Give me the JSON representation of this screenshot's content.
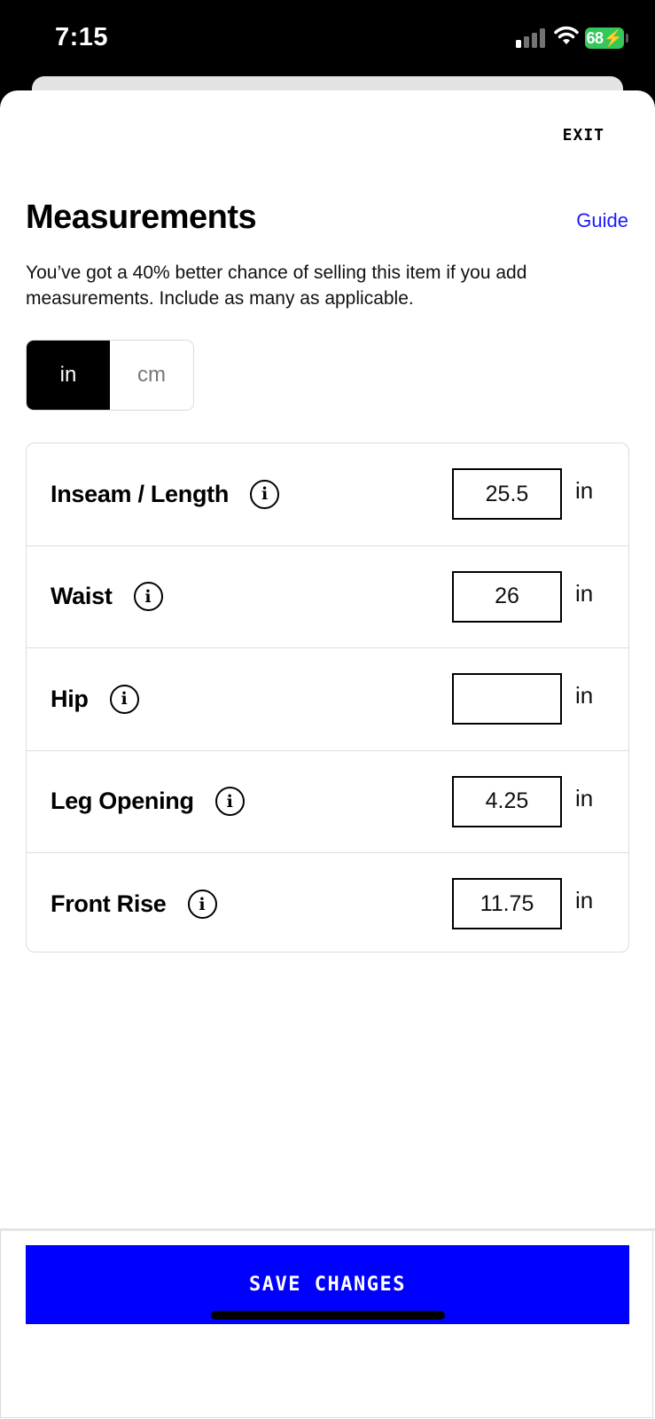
{
  "status_bar": {
    "time": "7:15",
    "battery_level": "68",
    "icons": [
      "signal-icon",
      "wifi-icon",
      "battery-charging-icon"
    ]
  },
  "header": {
    "exit_label": "EXIT",
    "title": "Measurements",
    "guide_label": "Guide",
    "description": "You’ve got a 40% better chance of selling this item if you add measurements. Include as many as applicable."
  },
  "units": {
    "options": [
      "in",
      "cm"
    ],
    "selected": "in"
  },
  "measurements": [
    {
      "label": "Inseam / Length",
      "value": "25.5",
      "unit": "in"
    },
    {
      "label": "Waist",
      "value": "26",
      "unit": "in"
    },
    {
      "label": "Hip",
      "value": "",
      "unit": "in"
    },
    {
      "label": "Leg Opening",
      "value": "4.25",
      "unit": "in"
    },
    {
      "label": "Front Rise",
      "value": "11.75",
      "unit": "in"
    }
  ],
  "footer": {
    "save_label": "SAVE CHANGES"
  },
  "colors": {
    "accent": "#0000FF",
    "guide_link": "#1A1AFF",
    "battery": "#34C759"
  }
}
